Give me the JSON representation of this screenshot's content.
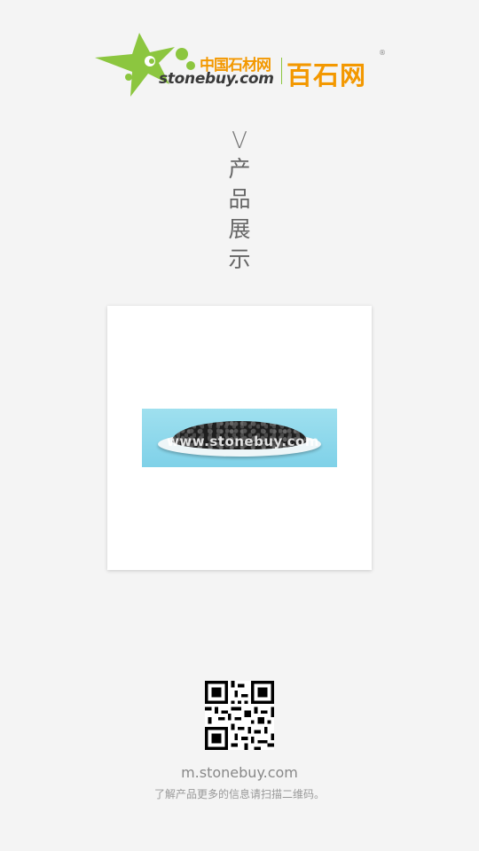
{
  "header": {
    "logo_cn": "中国石材网",
    "logo_en": "stonebuy.com",
    "brand": "百石网",
    "reg_mark": "®",
    "colors": {
      "green": "#8cc63f",
      "orange": "#f39800"
    }
  },
  "section_title": {
    "marker": "V",
    "chars": [
      "产",
      "品",
      "展",
      "示"
    ]
  },
  "product": {
    "watermark": "www.stonebuy.com",
    "image_icon": "product-photo"
  },
  "footer": {
    "qr_icon": "qr-code-icon",
    "url": "m.stonebuy.com",
    "note": "了解产品更多的信息请扫描二维码。"
  }
}
